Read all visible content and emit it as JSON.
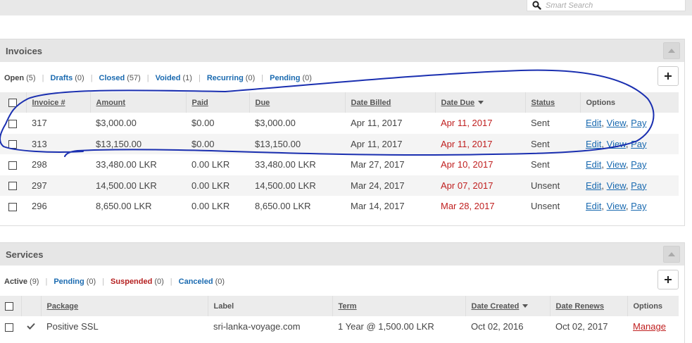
{
  "search": {
    "placeholder": "Smart Search"
  },
  "invoices": {
    "title": "Invoices",
    "filters": [
      {
        "label": "Open",
        "count": "(5)"
      },
      {
        "label": "Drafts",
        "count": "(0)"
      },
      {
        "label": "Closed",
        "count": "(57)"
      },
      {
        "label": "Voided",
        "count": "(1)"
      },
      {
        "label": "Recurring",
        "count": "(0)"
      },
      {
        "label": "Pending",
        "count": "(0)"
      }
    ],
    "add_label": "+",
    "columns": [
      "Invoice #",
      "Amount",
      "Paid",
      "Due",
      "Date Billed",
      "Date Due",
      "Status",
      "Options"
    ],
    "rows": [
      {
        "num": "317",
        "amount": "$3,000.00",
        "paid": "$0.00",
        "due": "$3,000.00",
        "billed": "Apr 11, 2017",
        "date_due": "Apr 11, 2017",
        "status": "Sent"
      },
      {
        "num": "313",
        "amount": "$13,150.00",
        "paid": "$0.00",
        "due": "$13,150.00",
        "billed": "Apr 11, 2017",
        "date_due": "Apr 11, 2017",
        "status": "Sent"
      },
      {
        "num": "298",
        "amount": "33,480.00 LKR",
        "paid": "0.00 LKR",
        "due": "33,480.00 LKR",
        "billed": "Mar 27, 2017",
        "date_due": "Apr 10, 2017",
        "status": "Sent"
      },
      {
        "num": "297",
        "amount": "14,500.00 LKR",
        "paid": "0.00 LKR",
        "due": "14,500.00 LKR",
        "billed": "Mar 24, 2017",
        "date_due": "Apr 07, 2017",
        "status": "Unsent"
      },
      {
        "num": "296",
        "amount": "8,650.00 LKR",
        "paid": "0.00 LKR",
        "due": "8,650.00 LKR",
        "billed": "Mar 14, 2017",
        "date_due": "Mar 28, 2017",
        "status": "Unsent"
      }
    ],
    "options": {
      "edit": "Edit",
      "view": "View",
      "pay": "Pay",
      "sep": ","
    }
  },
  "services": {
    "title": "Services",
    "filters": [
      {
        "label": "Active",
        "count": "(9)"
      },
      {
        "label": "Pending",
        "count": "(0)"
      },
      {
        "label": "Suspended",
        "count": "(0)"
      },
      {
        "label": "Canceled",
        "count": "(0)"
      }
    ],
    "add_label": "+",
    "columns": [
      "Package",
      "Label",
      "Term",
      "Date Created",
      "Date Renews",
      "Options"
    ],
    "rows": [
      {
        "package": "Positive SSL",
        "label": "sri-lanka-voyage.com",
        "term": "1 Year @ 1,500.00 LKR",
        "created": "Oct 02, 2016",
        "renews": "Oct 02, 2017",
        "option": "Manage"
      }
    ]
  },
  "colors": {
    "link": "#1a6ab0",
    "overdue": "#c02020",
    "annotation": "#1a2fb0"
  }
}
